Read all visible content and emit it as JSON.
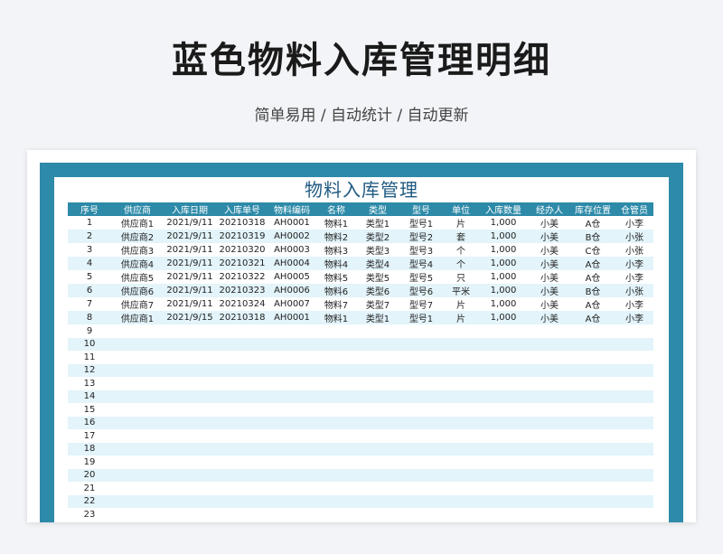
{
  "hero": {
    "title": "蓝色物料入库管理明细",
    "subtitle": "简单易用  /  自动统计  /  自动更新"
  },
  "sheet": {
    "title": "物料入库管理",
    "columns": [
      "序号",
      "供应商",
      "入库日期",
      "入库单号",
      "物料编码",
      "名称",
      "类型",
      "型号",
      "单位",
      "入库数量",
      "经办人",
      "库存位置",
      "仓管员"
    ],
    "rows": [
      [
        "1",
        "供应商1",
        "2021/9/11",
        "20210318",
        "AH0001",
        "物料1",
        "类型1",
        "型号1",
        "片",
        "1,000",
        "小美",
        "A仓",
        "小李"
      ],
      [
        "2",
        "供应商2",
        "2021/9/11",
        "20210319",
        "AH0002",
        "物料2",
        "类型2",
        "型号2",
        "套",
        "1,000",
        "小美",
        "B仓",
        "小张"
      ],
      [
        "3",
        "供应商3",
        "2021/9/11",
        "20210320",
        "AH0003",
        "物料3",
        "类型3",
        "型号3",
        "个",
        "1,000",
        "小美",
        "C仓",
        "小张"
      ],
      [
        "4",
        "供应商4",
        "2021/9/11",
        "20210321",
        "AH0004",
        "物料4",
        "类型4",
        "型号4",
        "个",
        "1,000",
        "小美",
        "A仓",
        "小李"
      ],
      [
        "5",
        "供应商5",
        "2021/9/11",
        "20210322",
        "AH0005",
        "物料5",
        "类型5",
        "型号5",
        "只",
        "1,000",
        "小美",
        "A仓",
        "小李"
      ],
      [
        "6",
        "供应商6",
        "2021/9/11",
        "20210323",
        "AH0006",
        "物料6",
        "类型6",
        "型号6",
        "平米",
        "1,000",
        "小美",
        "B仓",
        "小张"
      ],
      [
        "7",
        "供应商7",
        "2021/9/11",
        "20210324",
        "AH0007",
        "物料7",
        "类型7",
        "型号7",
        "片",
        "1,000",
        "小美",
        "A仓",
        "小李"
      ],
      [
        "8",
        "供应商1",
        "2021/9/15",
        "20210318",
        "AH0001",
        "物料1",
        "类型1",
        "型号1",
        "片",
        "1,000",
        "小美",
        "A仓",
        "小李"
      ],
      [
        "9",
        "",
        "",
        "",
        "",
        "",
        "",
        "",
        "",
        "",
        "",
        "",
        ""
      ],
      [
        "10",
        "",
        "",
        "",
        "",
        "",
        "",
        "",
        "",
        "",
        "",
        "",
        ""
      ],
      [
        "11",
        "",
        "",
        "",
        "",
        "",
        "",
        "",
        "",
        "",
        "",
        "",
        ""
      ],
      [
        "12",
        "",
        "",
        "",
        "",
        "",
        "",
        "",
        "",
        "",
        "",
        "",
        ""
      ],
      [
        "13",
        "",
        "",
        "",
        "",
        "",
        "",
        "",
        "",
        "",
        "",
        "",
        ""
      ],
      [
        "14",
        "",
        "",
        "",
        "",
        "",
        "",
        "",
        "",
        "",
        "",
        "",
        ""
      ],
      [
        "15",
        "",
        "",
        "",
        "",
        "",
        "",
        "",
        "",
        "",
        "",
        "",
        ""
      ],
      [
        "16",
        "",
        "",
        "",
        "",
        "",
        "",
        "",
        "",
        "",
        "",
        "",
        ""
      ],
      [
        "17",
        "",
        "",
        "",
        "",
        "",
        "",
        "",
        "",
        "",
        "",
        "",
        ""
      ],
      [
        "18",
        "",
        "",
        "",
        "",
        "",
        "",
        "",
        "",
        "",
        "",
        "",
        ""
      ],
      [
        "19",
        "",
        "",
        "",
        "",
        "",
        "",
        "",
        "",
        "",
        "",
        "",
        ""
      ],
      [
        "20",
        "",
        "",
        "",
        "",
        "",
        "",
        "",
        "",
        "",
        "",
        "",
        ""
      ],
      [
        "21",
        "",
        "",
        "",
        "",
        "",
        "",
        "",
        "",
        "",
        "",
        "",
        ""
      ],
      [
        "22",
        "",
        "",
        "",
        "",
        "",
        "",
        "",
        "",
        "",
        "",
        "",
        ""
      ],
      [
        "23",
        "",
        "",
        "",
        "",
        "",
        "",
        "",
        "",
        "",
        "",
        "",
        ""
      ]
    ]
  },
  "colors": {
    "accent": "#2d8aa8",
    "stripe": "#e3f4fa",
    "sheet_title": "#1f5a82"
  }
}
